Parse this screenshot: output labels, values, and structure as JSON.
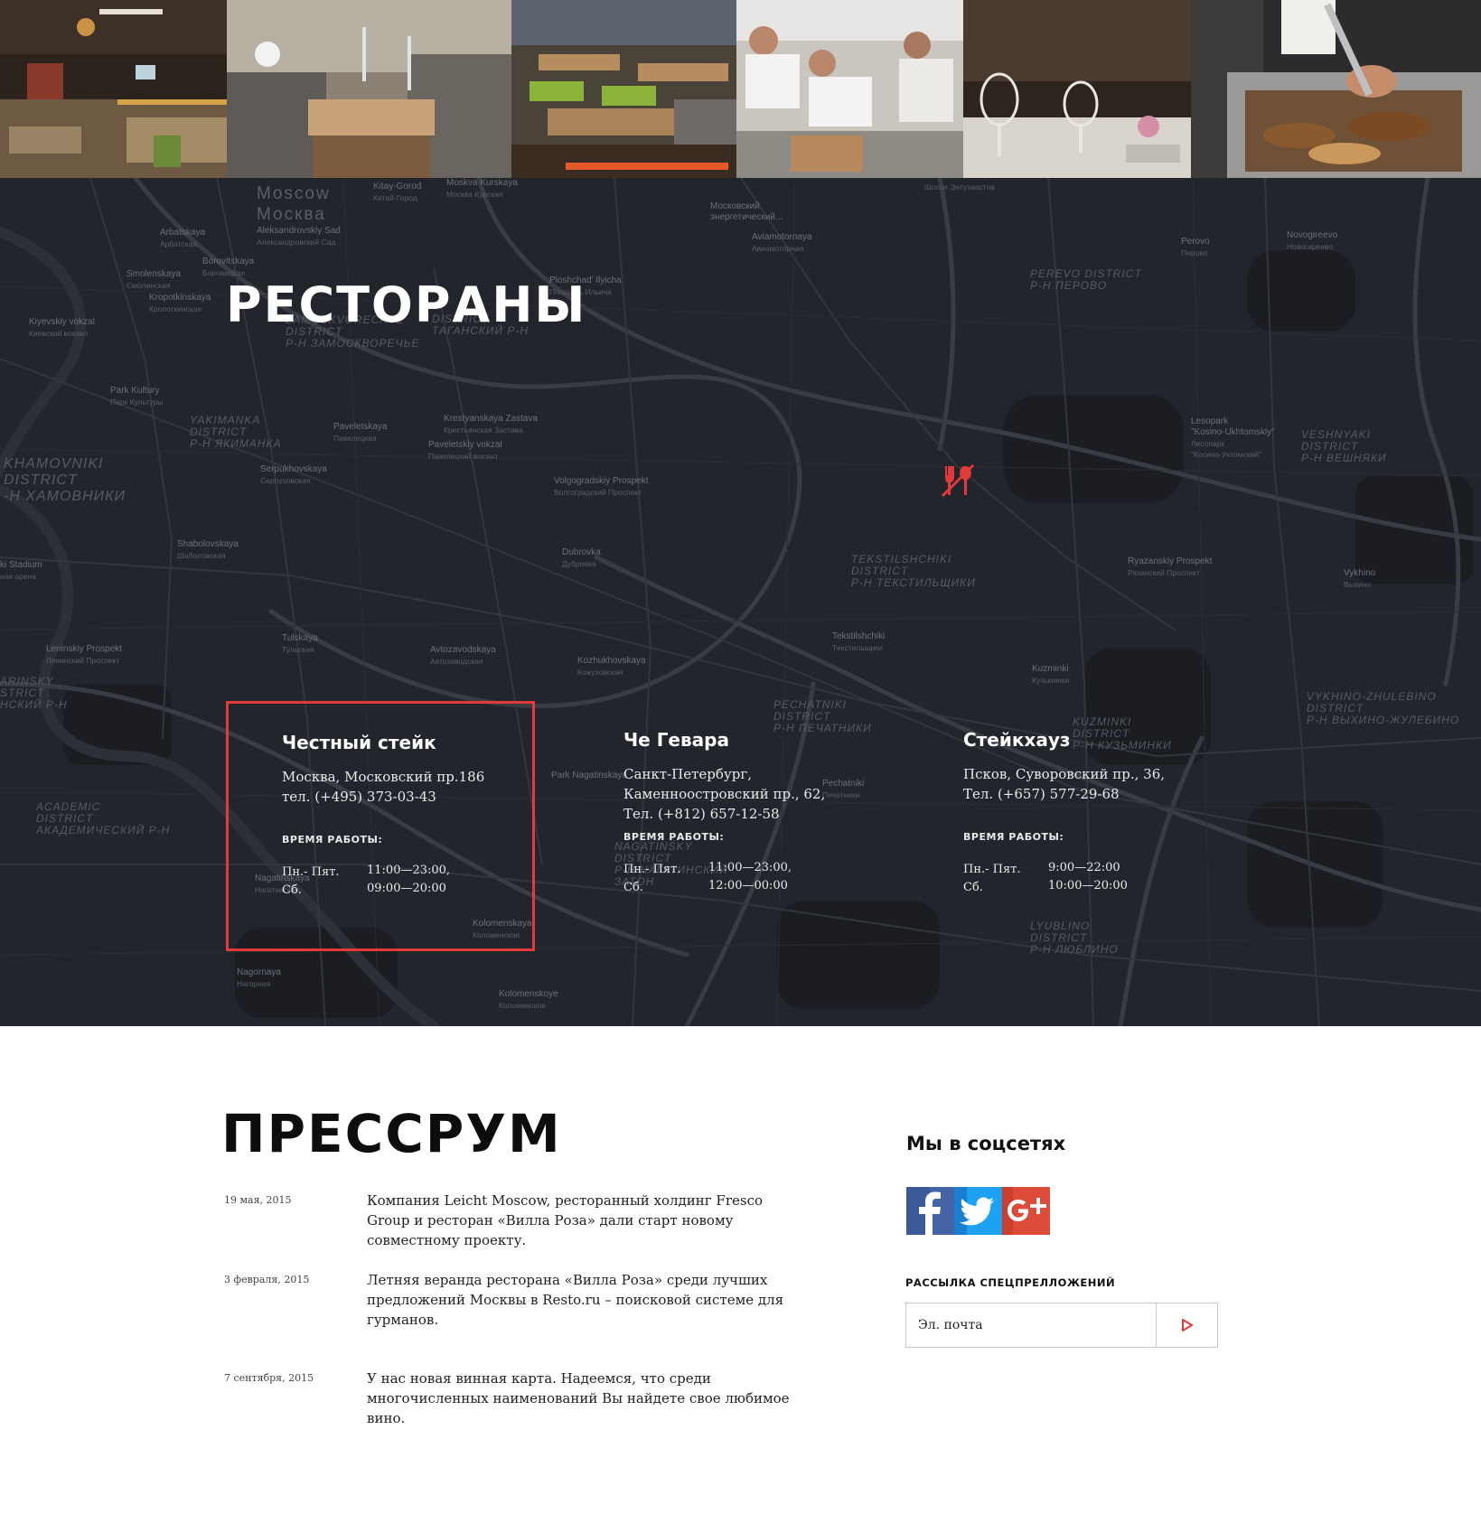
{
  "photos": [
    {
      "name": "restaurant-hall-photo"
    },
    {
      "name": "dining-chairs-photo"
    },
    {
      "name": "restaurant-tables-photo"
    },
    {
      "name": "chefs-kitchen-photo"
    },
    {
      "name": "wine-glasses-photo"
    },
    {
      "name": "grill-cooking-photo"
    }
  ],
  "map": {
    "labels": {
      "moscow_en": "Moscow",
      "moscow_ru": "Москва",
      "kitay_gorod": "Kitay-Gorod",
      "kitay_gorod_ru": "Китай-Город",
      "moskva_kurskaya": "Moskva Kurskaya",
      "moskva_kurskaya_ru": "Москва Курская",
      "arbatskaya": "Arbatskaya",
      "arbatskaya_ru": "Арбатская",
      "aleksandrovsky": "Aleksandrovskiy Sad",
      "aleksandrovsky_ru": "Александровский Сад",
      "smolenskaya": "Smolenskaya",
      "smolenskaya_ru": "Смоленская",
      "borovitskaya": "Borovitskaya",
      "borovitskaya_ru": "Боровицкая",
      "kropotkinskaya": "Kropotkinskaya",
      "kropotkinskaya_ru": "Кропоткинская",
      "kiyevskiy": "Kiyevskiy vokzal",
      "kiyevskiy_ru": "Киевский вокзал",
      "park_kultury": "Park Kultury",
      "park_kultury_ru": "Парк Культуры",
      "paveletskaya": "Paveletskaya",
      "paveletskaya_ru": "Павелецкая",
      "paveletskiy_vokzal": "Paveletskiy vokzal",
      "paveletskiy_vokzal_ru": "Павелецкий вокзал",
      "krestyanskaya": "Krestyanskaya Zastava",
      "krestyanskaya_ru": "Крестьянская Застава",
      "serpukhovskaya": "Serpukhovskaya",
      "serpukhovskaya_ru": "Серпуховская",
      "shabolovskaya": "Shabolovskaya",
      "shabolovskaya_ru": "Шаболовская",
      "tulskaya": "Tulskaya",
      "tulskaya_ru": "Тульская",
      "leninskiy": "Leninskiy Prospekt",
      "leninskiy_ru": "Ленинский Проспект",
      "volgogradskiy": "Volgogradskiy Prospekt",
      "volgogradskiy_ru": "Волгоградский Проспект",
      "dubrovka": "Dubrovka",
      "dubrovka_ru": "Дубровка",
      "avtozavodskaya": "Avtozavodskaya",
      "avtozavodskaya_ru": "Автозаводская",
      "kozhukhovskaya": "Kozhukhovskaya",
      "kozhukhovskaya_ru": "Кожуховская",
      "ploshchad": "Ploshchad' Ilyicha",
      "ploshchad_ru": "Площадь Ильича",
      "aviamotornaya": "Aviamotornaya",
      "aviamotornaya_ru": "Авиамоторная",
      "moskovsky_energ": "Московский энергетический...",
      "perovo": "Perovo",
      "perovo_ru": "Перово",
      "novogireevo": "Novogireevo",
      "novogireevo_ru": "Новогиреево",
      "shosse": "Шоссе Энтузиастов",
      "tekstilshchiki": "Tekstilshchiki",
      "tekstilshchiki_ru": "Текстильщики",
      "kuzminki": "Kuzminki",
      "kuzminki_ru": "Кузьминки",
      "ryazanskiy": "Ryazanskiy Prospekt",
      "ryazanskiy_ru": "Рязанский Проспект",
      "vykhino": "Vykhino",
      "vykhino_ru": "Выхино",
      "lesopark": "Lesopark",
      "lesopark2": "\"Kosino-Ukhtomskiy\"",
      "lesopark_ru": "Лесопарк",
      "lesopark_ru2": "\"Косино-Ухтомский\"",
      "nagatinskaya": "Nagatinskaya",
      "nagatinskaya_ru": "Нагатинская",
      "nagornaya": "Nagornaya",
      "nagornaya_ru": "Нагорная",
      "kolomenskaya": "Kolomenskaya",
      "kolomenskaya_ru": "Коломенская",
      "kolomenskoye": "Kolomenskoye",
      "kolomenskoye_ru": "Коломенское",
      "pechatniki": "Pechatniki",
      "pechatniki_ru": "Печатники",
      "stadium": "ki Stadium",
      "stadium_ru": "ная арена",
      "park_nagatinskaya": "Park Nagatinskaya",
      "d_zamoskvorechye": "Zamoskvorechye",
      "d_zamoskvorechye2": "District",
      "d_zamoskvorechye_ru": "Р-Н Замоскворечье",
      "d_taganskiy": "District",
      "d_taganskiy_ru": "Таганский р-н",
      "d_yakimanka": "Yakimanka",
      "d_yakimanka2": "District",
      "d_yakimanka_ru": "Р-Н Якиманка",
      "d_khamovniki": "Khamovniki",
      "d_khamovniki2": "District",
      "d_khamovniki_ru": "-Н Хамовники",
      "d_perovo": "Perevo District",
      "d_perovo_ru": "Р-Н Перово",
      "d_veshnyaki": "Veshnyaki",
      "d_veshnyaki2": "District",
      "d_veshnyaki_ru": "Р-Н Вешняки",
      "d_tekstil": "Tekstilshchiki",
      "d_tekstil2": "District",
      "d_tekstil_ru": "Р-Н Текстильщики",
      "d_pechatniki": "Pechatniki",
      "d_pechatniki2": "District",
      "d_pechatniki_ru": "Р-Н Печатники",
      "d_kuzminki": "Kuzminki",
      "d_kuzminki2": "District",
      "d_kuzminki_ru": "Р-Н Кузьминки",
      "d_vykhino": "Vykhino-Zhulebino",
      "d_vykhino2": "District",
      "d_vykhino_ru": "Р-Н Выхино-Жулебино",
      "d_nagatinsky": "Nagatinsky",
      "d_nagatinsky2": "District",
      "d_nagatinsky_ru": "Р-Н Нагатинский",
      "d_nagatinsky_ru2": "Затон",
      "d_lyublino": "Lyublino",
      "d_lyublino2": "District",
      "d_lyublino_ru": "Р-Н Люблино",
      "d_academic": "Academic",
      "d_academic2": "District",
      "d_academic_ru": "Академический р-н",
      "d_arinsky": "Arinsky",
      "d_arinsky2": "Strict",
      "d_arinsky_ru": "Нский р-н"
    }
  },
  "restaurants_section": {
    "title": "РЕСТОРАНЫ",
    "hours_title": "ВРЕМЯ РАБОТЫ:",
    "cards": [
      {
        "name": "Честный стейк",
        "address": "Москва, Московский пр.186\nтел. (+495) 373-03-43",
        "days": "Пн.- Пят.\nСб.",
        "times": "11:00—23:00,\n09:00—20:00"
      },
      {
        "name": "Че Гевара",
        "address": "Санкт-Петербург,\nКаменноостровский пр., 62,\nТел. (+812) 657-12-58",
        "days": "Пн.- Пят.\nСб.",
        "times": "11:00—23:00,\n12:00—00:00"
      },
      {
        "name": "Стейкхауз",
        "address": "Псков, Суворовский пр., 36,\nТел. (+657) 577-29-68",
        "days": "Пн.- Пят.\nСб.",
        "times": "9:00—22:00\n10:00—20:00"
      }
    ]
  },
  "press": {
    "title": "ПРЕССРУМ",
    "items": [
      {
        "date": "19 мая, 2015",
        "text": "Компания Leicht Moscow, ресторанный холдинг Fresco Group и ресторан «Вилла Роза» дали старт новому совместному проекту."
      },
      {
        "date": "3 февраля, 2015",
        "text": "Летняя веранда ресторана «Вилла Роза» среди лучших предложений Москвы в Resto.ru – поисковой системе для гурманов."
      },
      {
        "date": "7 сентября, 2015",
        "text": "У нас новая винная карта. Надеемся, что среди многочисленных наименований Вы найдете свое любимое вино."
      }
    ]
  },
  "social": {
    "title": "Мы в соцсетях",
    "icons": [
      "facebook-icon",
      "twitter-icon",
      "google-plus-icon"
    ],
    "colors": {
      "facebook": "#3b5998",
      "twitter": "#1da1f2",
      "google_plus": "#dd4b39"
    }
  },
  "newsletter": {
    "title": "РАССЫЛКА СПЕЦПРЕЛЛОЖЕНИЙ",
    "placeholder": "Эл. почта"
  },
  "colors": {
    "accent": "#e23a3a",
    "map_bg": "#23252c"
  }
}
